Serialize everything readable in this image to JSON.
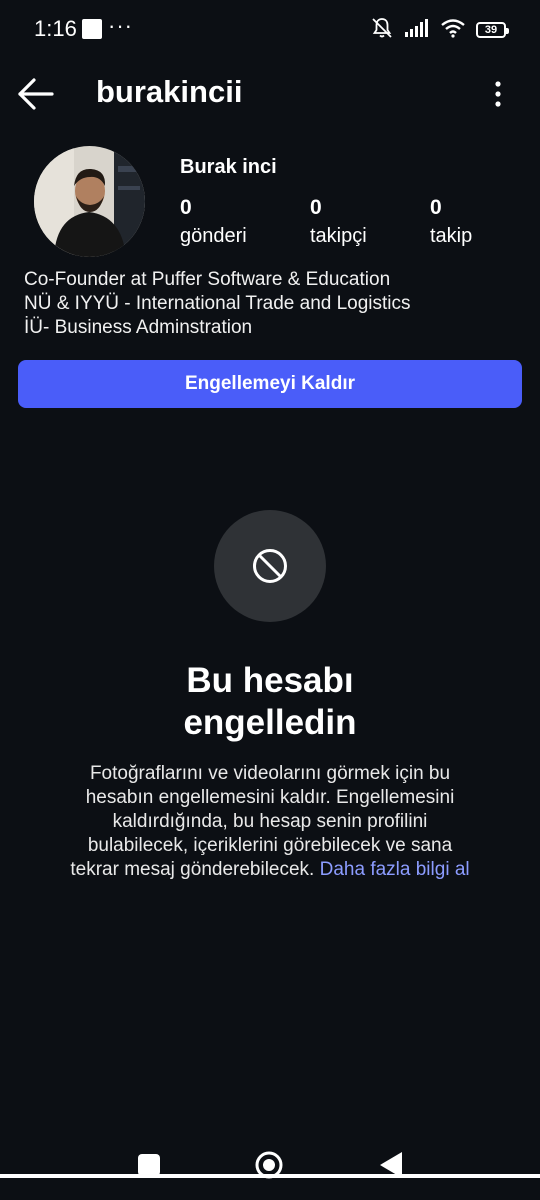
{
  "status_bar": {
    "time": "1:16",
    "more_indicator": "···",
    "battery": "39",
    "icons": [
      "notifications-muted-icon",
      "signal-icon",
      "wifi-icon",
      "battery-icon"
    ]
  },
  "header": {
    "username": "burakincii",
    "icons": [
      "back-arrow-icon",
      "more-vertical-icon"
    ]
  },
  "profile": {
    "display_name": "Burak inci",
    "stats": [
      {
        "value": "0",
        "label": "gönderi"
      },
      {
        "value": "0",
        "label": "takipçi"
      },
      {
        "value": "0",
        "label": "takip"
      }
    ],
    "bio_lines": [
      "Co-Founder at Puffer Software & Education",
      "NÜ & IYYÜ - International Trade and Logistics",
      "İÜ- Business Adminstration"
    ],
    "unblock_label": "Engellemeyi Kaldır"
  },
  "blocked": {
    "icon": "blocked-icon",
    "title_line1": "Bu hesabı",
    "title_line2": "engelledin",
    "description": "Fotoğraflarını ve videolarını görmek için bu hesabın engellemesini kaldır. Engellemesini kaldırdığında, bu hesap senin profilini bulabilecek, içeriklerini görebilecek ve sana tekrar mesaj gönderebilecek.",
    "learn_more": "Daha fazla bilgi al"
  },
  "colors": {
    "background": "#0c0f14",
    "accent": "#4a5df9",
    "link": "#8c9cff",
    "icon_circle": "#2f3236"
  }
}
